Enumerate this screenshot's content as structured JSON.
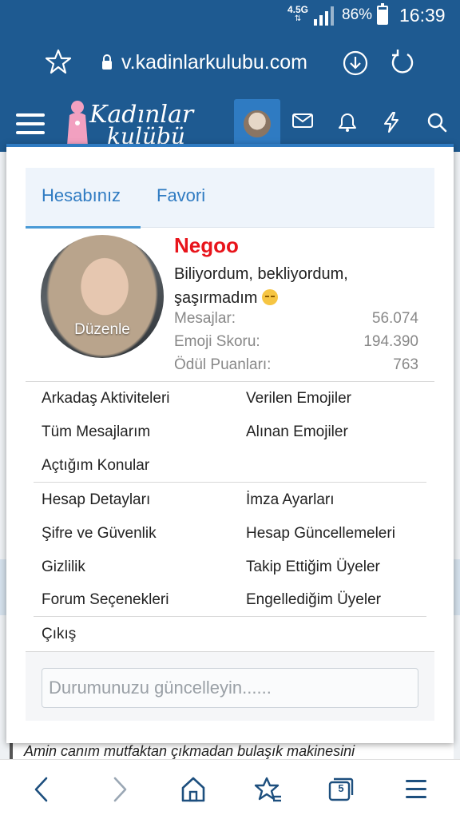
{
  "status_bar": {
    "network": "4.5G",
    "battery_percent": "86%",
    "battery_level": 0.86,
    "time": "16:39"
  },
  "browser": {
    "url": "v.kadinlarkulubu.com",
    "tab_count": "5"
  },
  "site": {
    "logo_line1": "Kadınlar",
    "logo_line2": "kulübü"
  },
  "popup": {
    "tabs": [
      {
        "label": "Hesabınız",
        "active": true
      },
      {
        "label": "Favori",
        "active": false
      }
    ],
    "avatar_edit_label": "Düzenle",
    "username": "Negoo",
    "status_text": "Biliyordum, bekliyordum, şaşırmadım",
    "stats": [
      {
        "label": "Mesajlar:",
        "value": "56.074"
      },
      {
        "label": "Emoji Skoru:",
        "value": "194.390"
      },
      {
        "label": "Ödül Puanları:",
        "value": "763"
      }
    ],
    "menu_group1": {
      "left": [
        "Arkadaş Aktiviteleri",
        "Tüm Mesajlarım",
        "Açtığım Konular"
      ],
      "right": [
        "Verilen Emojiler",
        "Alınan Emojiler"
      ]
    },
    "menu_group2": {
      "left": [
        "Hesap Detayları",
        "Şifre ve Güvenlik",
        "Gizlilik",
        "Forum Seçenekleri"
      ],
      "right": [
        "İmza Ayarları",
        "Hesap Güncellemeleri",
        "Takip Ettiğim Üyeler",
        "Engellediğim Üyeler"
      ]
    },
    "logout_label": "Çıkış",
    "status_placeholder": "Durumunuzu güncelleyin......"
  },
  "background_post_text": "Amin canım mutfaktan çıkmadan bulaşık makinesini",
  "colors": {
    "header_blue": "#1e5a91",
    "accent_blue": "#2f7bc2",
    "username_red": "#e8141b"
  }
}
